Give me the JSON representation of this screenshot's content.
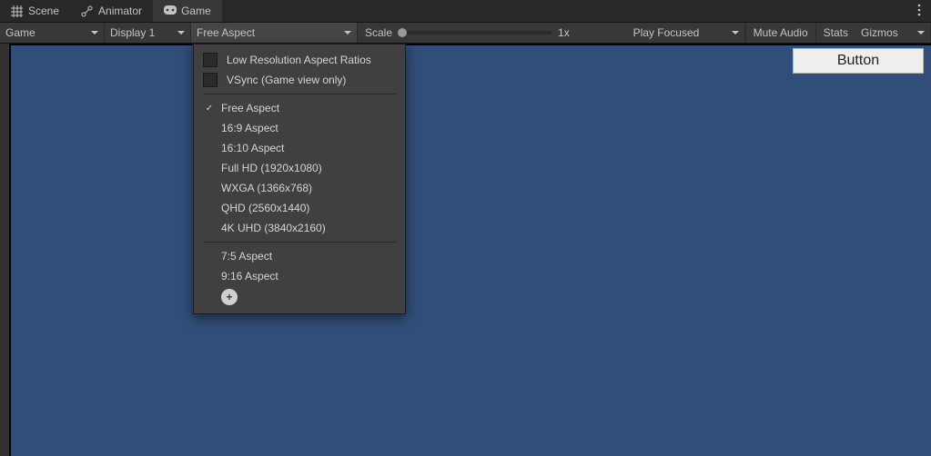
{
  "tabs": [
    {
      "label": "Scene",
      "icon": "grid"
    },
    {
      "label": "Animator",
      "icon": "animator"
    },
    {
      "label": "Game",
      "icon": "gamepad",
      "active": true
    }
  ],
  "toolbar": {
    "mode": "Game",
    "display": "Display 1",
    "aspect": "Free Aspect",
    "scale_label": "Scale",
    "scale_value": "1x",
    "play": "Play Focused",
    "mute": "Mute Audio",
    "stats": "Stats",
    "gizmos": "Gizmos"
  },
  "popup": {
    "checks": [
      {
        "label": "Low Resolution Aspect Ratios",
        "checked": false
      },
      {
        "label": "VSync (Game view only)",
        "checked": false
      }
    ],
    "builtin": [
      {
        "label": "Free Aspect",
        "checked": true
      },
      {
        "label": "16:9 Aspect"
      },
      {
        "label": "16:10 Aspect"
      },
      {
        "label": "Full HD (1920x1080)"
      },
      {
        "label": "WXGA (1366x768)"
      },
      {
        "label": "QHD (2560x1440)"
      },
      {
        "label": "4K UHD (3840x2160)"
      }
    ],
    "custom": [
      {
        "label": "7:5 Aspect"
      },
      {
        "label": "9:16 Aspect"
      }
    ]
  },
  "game_button": "Button"
}
